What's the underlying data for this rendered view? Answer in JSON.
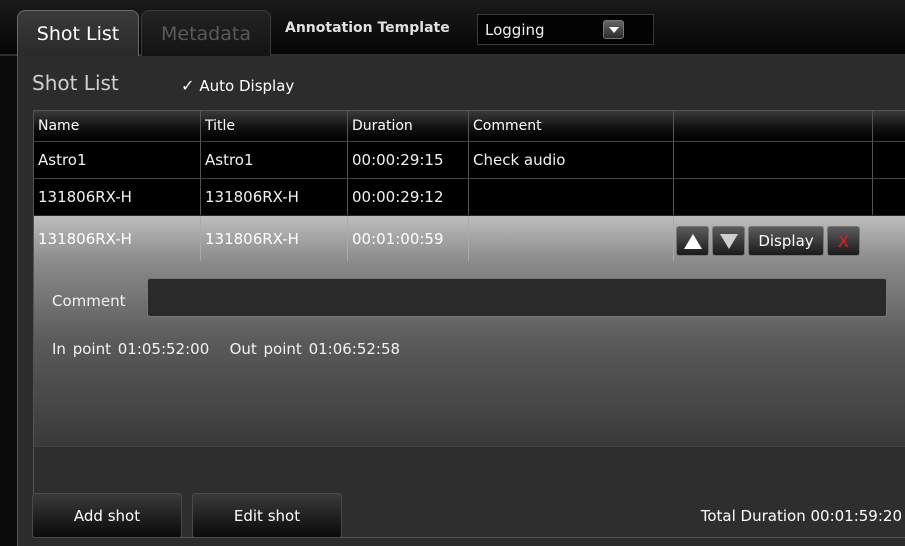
{
  "tabs": [
    {
      "label": "Shot List",
      "active": true
    },
    {
      "label": "Metadata",
      "active": false
    }
  ],
  "annotation": {
    "label": "Annotation Template",
    "selected": "Logging"
  },
  "panel": {
    "title": "Shot List",
    "auto_display": {
      "label": "Auto Display",
      "checked": true
    }
  },
  "table": {
    "headers": [
      "Name",
      "Title",
      "Duration",
      "Comment",
      "",
      ""
    ],
    "rows": [
      {
        "name": "Astro1",
        "title": "Astro1",
        "duration": "00:00:29:15",
        "comment": "Check audio"
      },
      {
        "name": "131806RX-H",
        "title": "131806RX-H",
        "duration": "00:00:29:12",
        "comment": ""
      },
      {
        "name": "131806RX-H",
        "title": "131806RX-H",
        "duration": "00:01:00:59",
        "comment": ""
      }
    ]
  },
  "selected": {
    "display_label": "Display",
    "delete_label": "X",
    "comment_label": "Comment",
    "comment_value": "",
    "in_point_label": "In point",
    "in_point": "01:05:52:00",
    "out_point_label": "Out point",
    "out_point": "01:06:52:58"
  },
  "footer": {
    "add_label": "Add shot",
    "edit_label": "Edit shot",
    "total_label": "Total Duration",
    "total_value": "00:01:59:20"
  },
  "colors": {
    "background": "#0b0b0b",
    "panel": "#2c2c2c",
    "delete": "#e02020"
  }
}
